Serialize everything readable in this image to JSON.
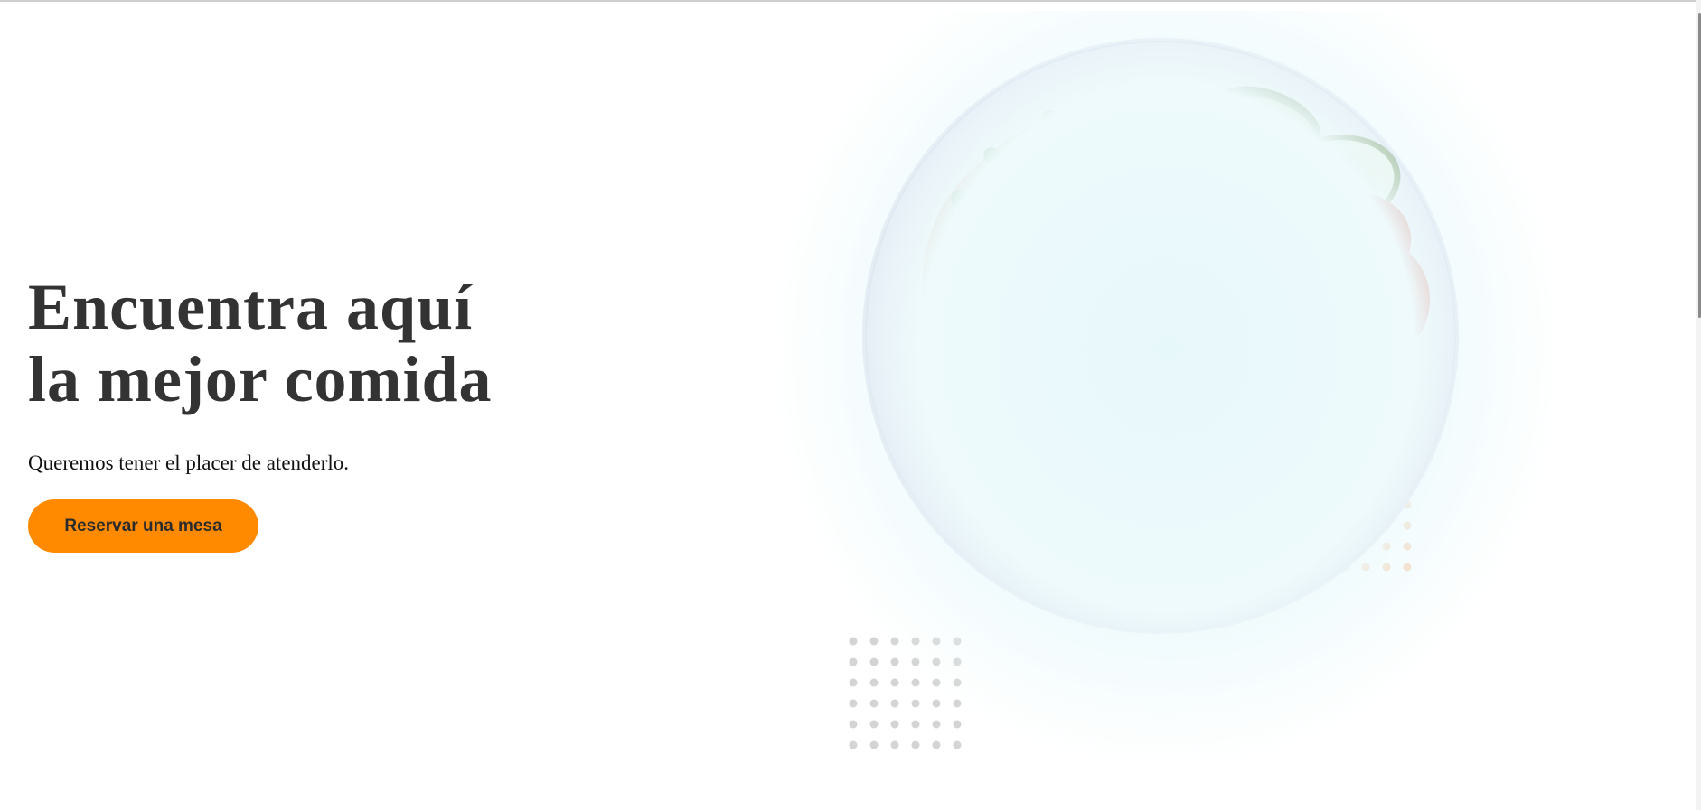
{
  "hero": {
    "title_line1": "Encuentra aquí",
    "title_line2": "la mejor comida",
    "subtitle": "Queremos tener el placer de atenderlo.",
    "cta_label": "Reservar una mesa"
  },
  "colors": {
    "accent": "#ff8a00",
    "title": "#333333",
    "dots_orange": "#f6c9a2",
    "dots_gray": "#d4d4d4"
  },
  "image": {
    "subject": "plate of spaghetti with tomato sauce, peas, corn, carrots, cucumber, tomato and lettuce"
  }
}
